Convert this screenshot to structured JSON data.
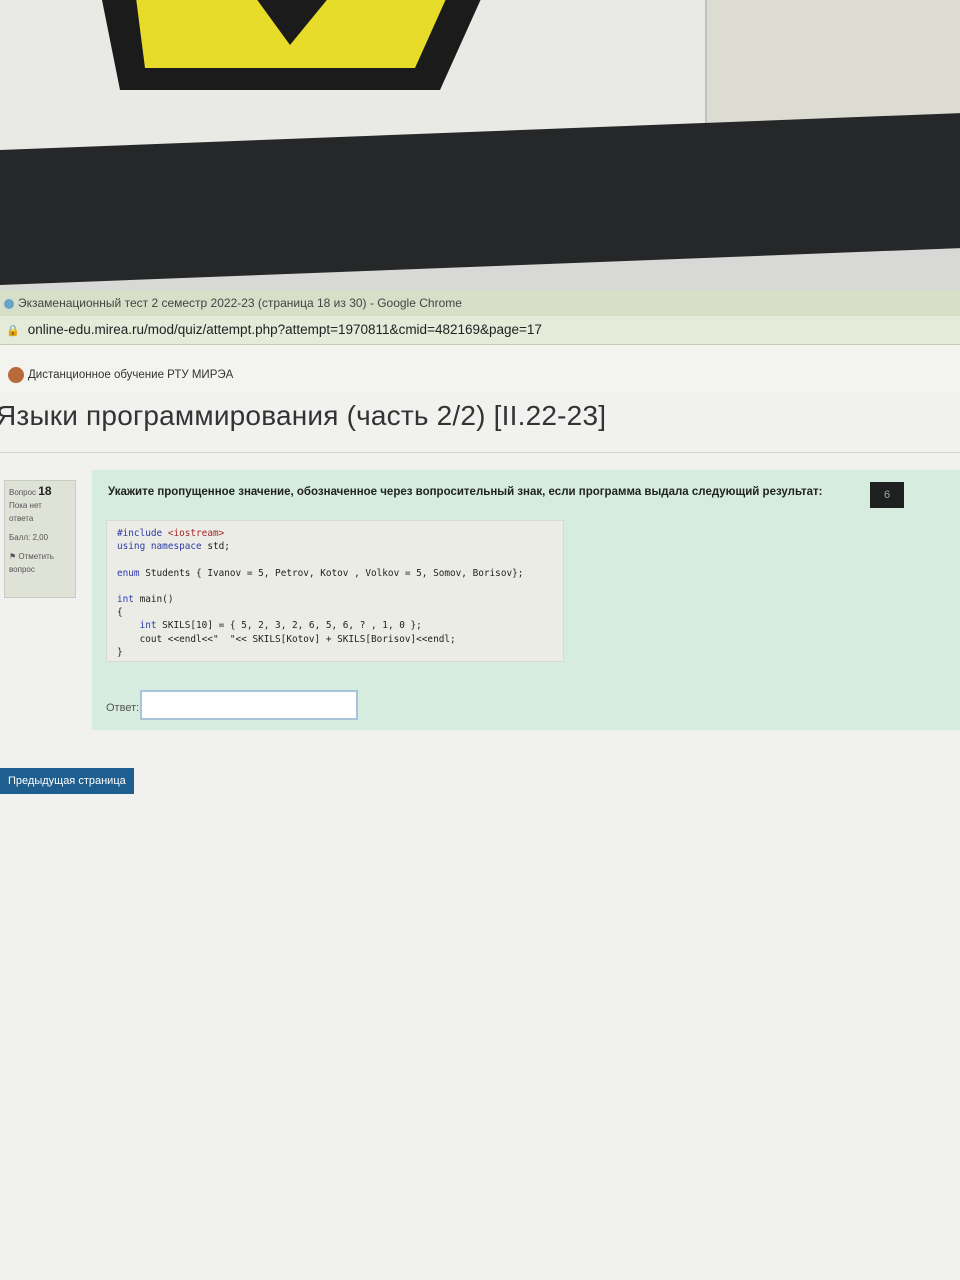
{
  "window": {
    "title": "Экзаменационный тест 2 семестр 2022-23 (страница 18 из 30) - Google Chrome",
    "url": "online-edu.mirea.ru/mod/quiz/attempt.php?attempt=1970811&cmid=482169&page=17"
  },
  "site": {
    "name": "Дистанционное обучение РТУ МИРЭА"
  },
  "course": {
    "title": "Языки программирования (часть 2/2) [II.22-23]"
  },
  "question_info": {
    "label": "Вопрос",
    "number": "18",
    "status_line1": "Пока нет",
    "status_line2": "ответа",
    "grade": "Балл: 2,00",
    "flag_line1": "Отметить",
    "flag_line2": "вопрос"
  },
  "question": {
    "text": "Укажите пропущенное значение, обозначенное через вопросительный знак, если программа выдала следующий результат:",
    "result": "6",
    "code": {
      "l1_kw": "#include",
      "l1_hdr": "<iostream>",
      "l2_kw1": "using",
      "l2_kw2": "namespace",
      "l2_rest": "std;",
      "l3_kw": "enum",
      "l3_rest": "Students { Ivanov = 5, Petrov, Kotov , Volkov = 5, Somov, Borisov};",
      "l4_kw": "int",
      "l4_rest": "main()",
      "l5": "{",
      "l6_kw": "int",
      "l6_rest": "SKILS[10] = { 5, 2, 3, 2, 6, 5, 6, ? , 1, 0 };",
      "l7": "cout <<endl<<\"  \"<< SKILS[Kotov] + SKILS[Borisov]<<endl;",
      "l8": "}"
    }
  },
  "answer": {
    "label": "Ответ:",
    "value": ""
  },
  "nav": {
    "prev_label": "Предыдущая страница"
  },
  "colors": {
    "question_bg": "#d5ecdf",
    "prev_button": "#1f5f8f",
    "sign_yellow": "#e8dc2a"
  }
}
